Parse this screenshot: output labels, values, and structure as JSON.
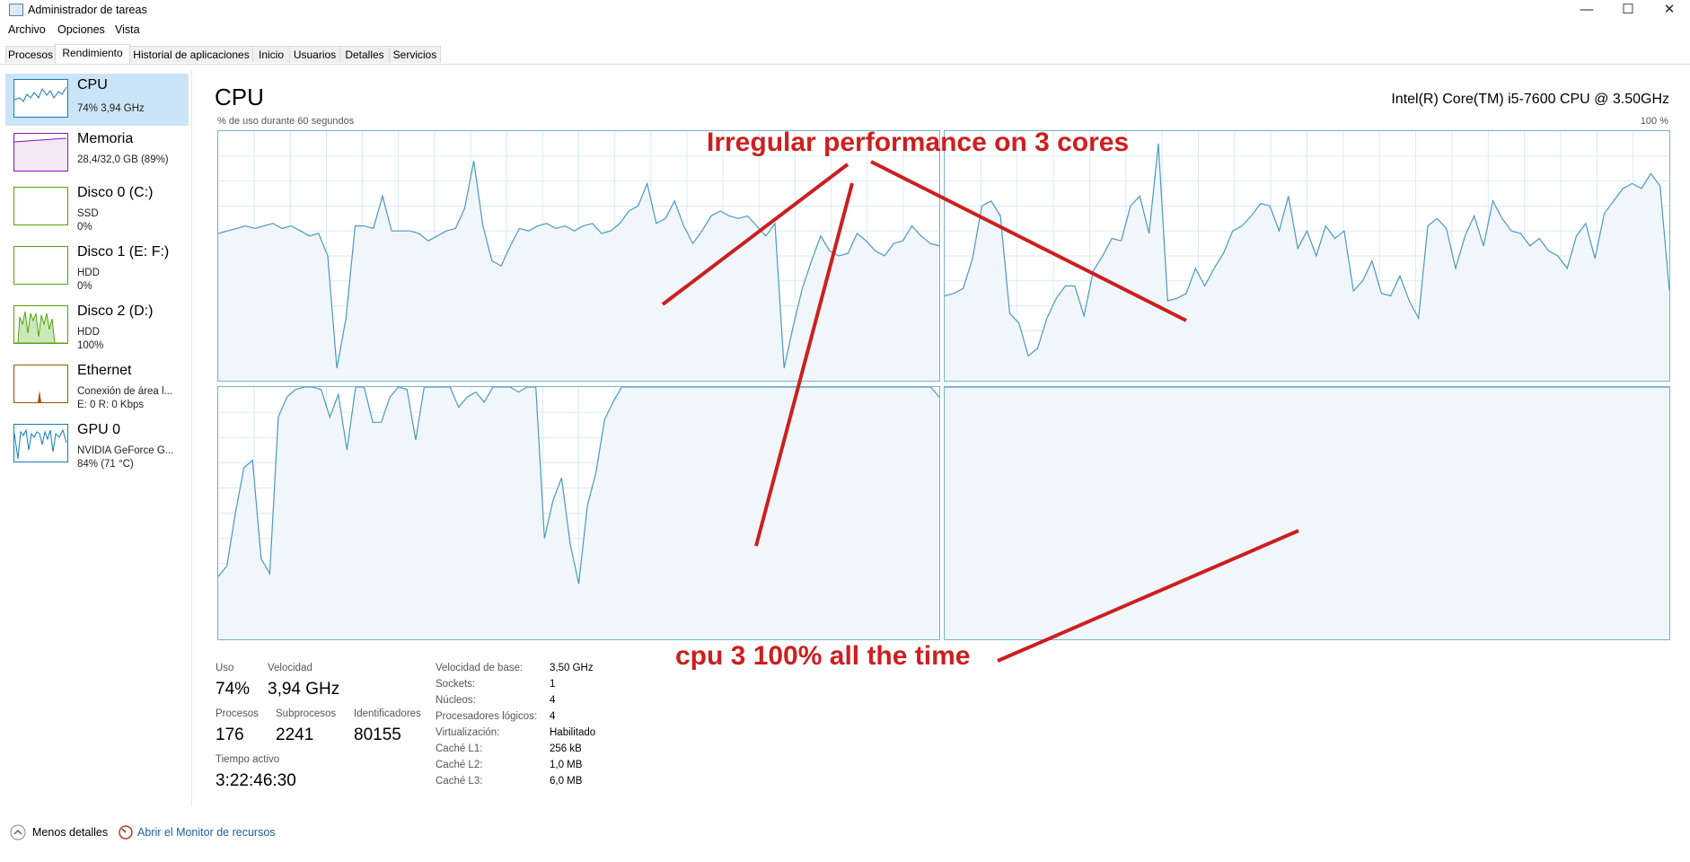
{
  "window": {
    "title": "Administrador de tareas",
    "minimize_glyph": "—",
    "maximize_glyph": "☐",
    "close_glyph": "✕"
  },
  "menu": [
    "Archivo",
    "Opciones",
    "Vista"
  ],
  "tabs": [
    "Procesos",
    "Rendimiento",
    "Historial de aplicaciones",
    "Inicio",
    "Usuarios",
    "Detalles",
    "Servicios"
  ],
  "active_tab": "Rendimiento",
  "sidebar": [
    {
      "name": "CPU",
      "line1": "74% 3,94 GHz",
      "line2": "",
      "color": "#117dbb",
      "selected": true
    },
    {
      "name": "Memoria",
      "line1": "28,4/32,0 GB (89%)",
      "line2": "",
      "color": "#8b12ae",
      "selected": false
    },
    {
      "name": "Disco 0 (C:)",
      "line1": "SSD",
      "line2": "0%",
      "color": "#4da60c",
      "selected": false
    },
    {
      "name": "Disco 1 (E: F:)",
      "line1": "HDD",
      "line2": "0%",
      "color": "#4da60c",
      "selected": false
    },
    {
      "name": "Disco 2 (D:)",
      "line1": "HDD",
      "line2": "100%",
      "color": "#4da60c",
      "selected": false
    },
    {
      "name": "Ethernet",
      "line1": "Conexión de área l...",
      "line2": "E: 0 R: 0 Kbps",
      "color": "#a74f01",
      "selected": false
    },
    {
      "name": "GPU 0",
      "line1": "NVIDIA GeForce G...",
      "line2": "84% (71 °C)",
      "color": "#117dbb",
      "selected": false
    }
  ],
  "main": {
    "title": "CPU",
    "model": "Intel(R) Core(TM) i5-7600 CPU @ 3.50GHz",
    "graph_label_left": "% de uso durante 60 segundos",
    "graph_label_right": "100 %"
  },
  "stats": {
    "uso_label": "Uso",
    "uso_value": "74%",
    "velocidad_label": "Velocidad",
    "velocidad_value": "3,94 GHz",
    "procesos_label": "Procesos",
    "procesos_value": "176",
    "subprocesos_label": "Subprocesos",
    "subprocesos_value": "2241",
    "identificadores_label": "Identificadores",
    "identificadores_value": "80155",
    "tiempo_label": "Tiempo activo",
    "tiempo_value": "3:22:46:30"
  },
  "info": [
    {
      "label": "Velocidad de base:",
      "value": "3,50 GHz"
    },
    {
      "label": "Sockets:",
      "value": "1"
    },
    {
      "label": "Núcleos:",
      "value": "4"
    },
    {
      "label": "Procesadores lógicos:",
      "value": "4"
    },
    {
      "label": "Virtualización:",
      "value": "Habilitado"
    },
    {
      "label": "Caché L1:",
      "value": "256 kB"
    },
    {
      "label": "Caché L2:",
      "value": "1,0 MB"
    },
    {
      "label": "Caché L3:",
      "value": "6,0 MB"
    }
  ],
  "footer": {
    "less_details": "Menos detalles",
    "open_monitor": "Abrir el Monitor de recursos"
  },
  "annotations": {
    "top": "Irregular performance on 3 cores",
    "bottom": "cpu 3 100% all the time",
    "color": "#cc1f1f"
  },
  "core_graphs": [
    {
      "name": "core-0",
      "values": [
        59,
        60,
        61,
        62,
        61,
        62,
        63,
        61,
        62,
        60,
        58,
        59,
        50,
        5,
        25,
        62,
        62,
        61,
        74,
        60,
        60,
        60,
        59,
        56,
        58,
        60,
        61,
        69,
        88,
        62,
        48,
        46,
        54,
        61,
        60,
        62,
        63,
        61,
        62,
        60,
        62,
        63,
        59,
        60,
        63,
        68,
        70,
        79,
        63,
        65,
        72,
        62,
        55,
        60,
        66,
        68,
        66,
        65,
        66,
        62,
        58,
        63,
        5,
        22,
        37,
        48,
        58,
        52,
        50,
        51,
        59,
        56,
        52,
        50,
        55,
        56,
        62,
        58,
        55,
        54
      ]
    },
    {
      "name": "core-1",
      "values": [
        34,
        35,
        37,
        49,
        70,
        72,
        66,
        27,
        23,
        10,
        13,
        25,
        33,
        38,
        38,
        26,
        44,
        50,
        57,
        56,
        70,
        74,
        59,
        95,
        32,
        33,
        35,
        45,
        38,
        45,
        51,
        60,
        62,
        66,
        71,
        70,
        60,
        74,
        53,
        60,
        50,
        62,
        57,
        60,
        36,
        40,
        48,
        35,
        34,
        42,
        32,
        25,
        62,
        65,
        61,
        45,
        58,
        66,
        54,
        72,
        65,
        60,
        59,
        54,
        57,
        52,
        50,
        45,
        58,
        63,
        49,
        67,
        72,
        77,
        79,
        77,
        83,
        78,
        36
      ]
    },
    {
      "name": "core-2",
      "values": [
        25,
        29,
        50,
        68,
        71,
        32,
        26,
        88,
        96,
        99,
        100,
        100,
        99,
        88,
        97,
        75,
        100,
        100,
        86,
        86,
        96,
        100,
        99,
        79,
        100,
        100,
        100,
        100,
        92,
        96,
        98,
        94,
        100,
        100,
        100,
        98,
        100,
        100,
        40,
        55,
        64,
        38,
        22,
        53,
        66,
        87,
        94,
        100,
        100,
        100,
        100,
        100,
        100,
        100,
        100,
        100,
        100,
        100,
        100,
        100,
        100,
        100,
        100,
        100,
        100,
        100,
        100,
        100,
        100,
        100,
        100,
        100,
        100,
        100,
        100,
        100,
        100,
        100,
        100,
        100,
        100,
        100,
        100,
        100,
        96
      ]
    },
    {
      "name": "core-3",
      "values": [
        100,
        100,
        100,
        100,
        100,
        100,
        100,
        100,
        100,
        100,
        100,
        100,
        100,
        100,
        100,
        100,
        100,
        100,
        100,
        100,
        100,
        100,
        100,
        100,
        100,
        100,
        100,
        100,
        100,
        100,
        100,
        100,
        100,
        100,
        100,
        100,
        100,
        100,
        100,
        100,
        100,
        100,
        100,
        100,
        100,
        100,
        100,
        100,
        100,
        100,
        100,
        100,
        100,
        100,
        100,
        100,
        100,
        100,
        100,
        100
      ]
    }
  ]
}
